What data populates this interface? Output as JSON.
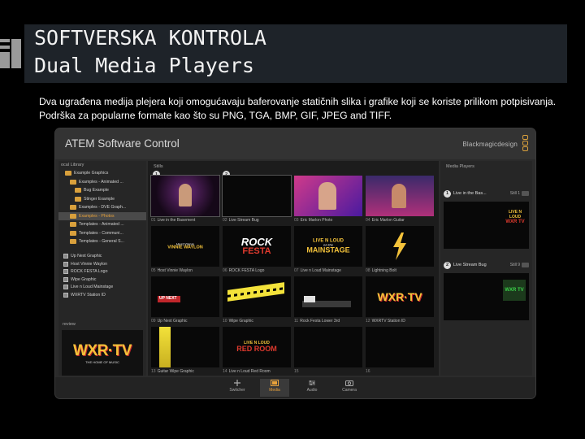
{
  "slide": {
    "title_line1": "SOFTVERSKA KONTROLA",
    "title_line2": "Dual Media Players",
    "body_line1": "Dva ugrađena medija plejera koji omogućavaju baferovanje statičnih slika i grafike koji se koriste prilikom potpisivanja.",
    "body_line2": "Podrška za popularne formate kao što su PNG, TGA, BMP, GIF, JPEG and TIFF."
  },
  "app": {
    "title": "ATEM Software Control",
    "brand": "Blackmagicdesign",
    "local_library_label": "ocal Library",
    "folders": [
      "Example Graphics",
      "Examples - Animated ...",
      "Bug Example",
      "Stinger Example",
      "Examples - DVE Graph...",
      "Examples - Photos",
      "Templates - Animated ...",
      "Templates - Communi...",
      "Templates - General S..."
    ],
    "files": [
      "Up Next Graphic",
      "Host Vinnie Waylon",
      "ROCK FESTA Logo",
      "Wipe Graphic",
      "Live n Loud Mainstage",
      "WXRTV Station ID"
    ],
    "preview_label": "review",
    "stills_label": "Stills",
    "stills": [
      {
        "num": "01",
        "name": "Live in the Basement"
      },
      {
        "num": "02",
        "name": "Live Stream Bug"
      },
      {
        "num": "03",
        "name": "Eric Marlon Photo"
      },
      {
        "num": "04",
        "name": "Eric Marlon Guitar"
      },
      {
        "num": "05",
        "name": "Host Vinnie Waylon"
      },
      {
        "num": "06",
        "name": "ROCK FESTA Logo"
      },
      {
        "num": "07",
        "name": "Live n Loud Mainstage"
      },
      {
        "num": "08",
        "name": "Lightning Bolt"
      },
      {
        "num": "09",
        "name": "Up Next Graphic"
      },
      {
        "num": "10",
        "name": "Wipe Graphic"
      },
      {
        "num": "11",
        "name": "Rock Festa Lower 3rd"
      },
      {
        "num": "12",
        "name": "WXRTV Station ID"
      },
      {
        "num": "13",
        "name": "Guitar Wipe Graphic"
      },
      {
        "num": "14",
        "name": "Live n Loud Red Room"
      },
      {
        "num": "15",
        "name": ""
      },
      {
        "num": "16",
        "name": ""
      }
    ],
    "media_players_label": "Media Players",
    "mp1": {
      "num": "1",
      "name": "Live in the Bas...",
      "still": "Still 1"
    },
    "mp2": {
      "num": "2",
      "name": "Live Stream Bug",
      "still": "Still 9"
    },
    "thumb_text": {
      "host_small": "Host Vinnie",
      "host_name": "VINNIE WAYLON",
      "rock": "ROCK",
      "festa": "FESTA",
      "live_loud": "LIVE N LOUD",
      "on_the": "on the",
      "mainstage": "MAINSTAGE",
      "up_next": "UP NEXT",
      "wxrtv": "WXR·TV",
      "wxr_small": "THE HOME OF MUSIC",
      "red_room": "RED ROOM",
      "bug_tv": "WXR TV"
    },
    "tabs": [
      {
        "label": "Switcher"
      },
      {
        "label": "Media"
      },
      {
        "label": "Audio"
      },
      {
        "label": "Camera"
      }
    ],
    "accent": "#e8a23a"
  }
}
